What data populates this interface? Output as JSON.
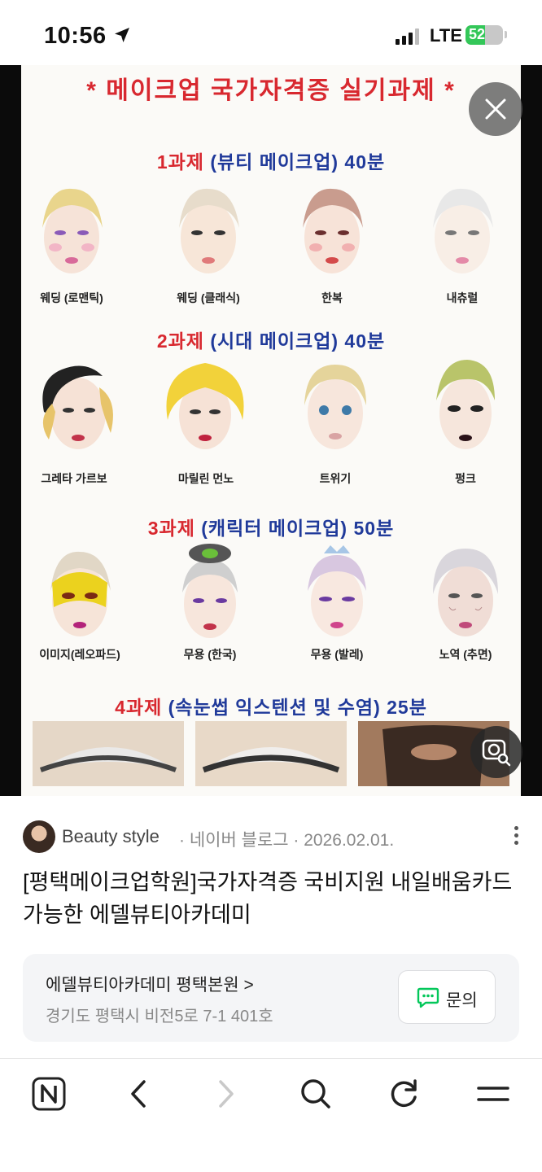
{
  "status_bar": {
    "time": "10:56",
    "network": "LTE",
    "battery": "52",
    "icons": [
      "location-arrow-icon",
      "signal-icon",
      "battery-icon"
    ]
  },
  "poster": {
    "title": "* 메이크업 국가자격증 실기과제 *",
    "sections": [
      {
        "num": "1과제",
        "rest": "(뷰티 메이크업) 40분",
        "captions": [
          "웨딩 (로맨틱)",
          "웨딩 (클래식)",
          "한복",
          "내츄럴"
        ]
      },
      {
        "num": "2과제",
        "rest": "(시대 메이크업) 40분",
        "captions": [
          "그레타 가르보",
          "마릴린 먼노",
          "트위기",
          "펑크"
        ]
      },
      {
        "num": "3과제",
        "rest": "(캐릭터 메이크업) 50분",
        "captions": [
          "이미지(레오파드)",
          "무용 (한국)",
          "무용 (발레)",
          "노역 (추면)"
        ]
      },
      {
        "num": "4과제",
        "rest": "(속눈썹 익스텐션 및 수염) 25분",
        "captions": []
      }
    ]
  },
  "overlay": {
    "close_icon": "close-icon",
    "lens_icon": "image-search-icon"
  },
  "post": {
    "source_name": "Beauty style",
    "source_meta": "· 네이버 블로그 · 2026.02.01.",
    "title": "[평택메이크업학원]국가자격증 국비지원 내일배움카드 가능한 에델뷰티아카데미"
  },
  "place": {
    "name": "에델뷰티아카데미 평택본원 >",
    "address": "경기도 평택시 비전5로 7-1 401호",
    "inquiry_label": "문의"
  },
  "toolbar": {
    "items": [
      "naver-home-icon",
      "back-icon",
      "forward-icon",
      "search-icon",
      "refresh-icon",
      "menu-icon"
    ]
  },
  "colors": {
    "title_red": "#d8282f",
    "section_blue": "#203a9a",
    "inquiry_green": "#03c75a",
    "battery_green": "#34c759"
  }
}
